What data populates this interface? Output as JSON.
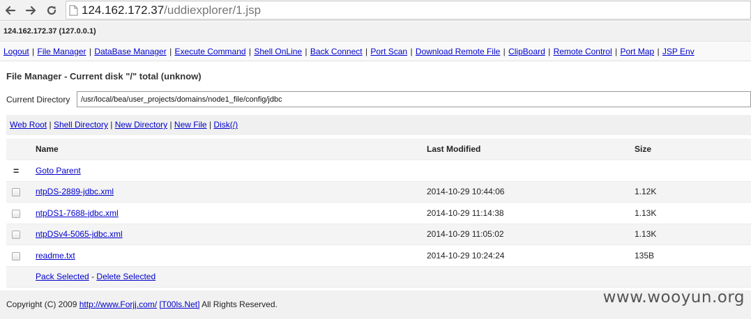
{
  "browser": {
    "url_host": "124.162.172.37",
    "url_path": "/uddiexplorer/1.jsp"
  },
  "host_header": "124.162.172.37 (127.0.0.1)",
  "menu": {
    "items": [
      "Logout",
      "File Manager",
      "DataBase Manager",
      "Execute Command",
      "Shell OnLine",
      "Back Connect",
      "Port Scan",
      "Download Remote File",
      "ClipBoard",
      "Remote Control",
      "Port Map",
      "JSP Env"
    ]
  },
  "file_manager": {
    "title": "File Manager - Current disk \"/\" total (unknow)",
    "current_dir_label": "Current Directory",
    "current_dir_value": "/usr/local/bea/user_projects/domains/node1_file/config/jdbc",
    "links": [
      "Web Root",
      "Shell Directory",
      "New Directory",
      "New File",
      "Disk(/)"
    ],
    "table": {
      "headers": {
        "name": "Name",
        "modified": "Last Modified",
        "size": "Size"
      },
      "parent_glyph": "=",
      "parent_label": "Goto Parent",
      "rows": [
        {
          "name": "ntpDS-2889-jdbc.xml",
          "modified": "2014-10-29 10:44:06",
          "size": "1.12K"
        },
        {
          "name": "ntpDS1-7688-jdbc.xml",
          "modified": "2014-10-29 11:14:38",
          "size": "1.13K"
        },
        {
          "name": "ntpDSv4-5065-jdbc.xml",
          "modified": "2014-10-29 11:05:02",
          "size": "1.13K"
        },
        {
          "name": "readme.txt",
          "modified": "2014-10-29 10:24:24",
          "size": "135B"
        }
      ],
      "pack_selected": "Pack Selected",
      "action_separator": "-",
      "delete_selected": "Delete Selected"
    }
  },
  "footer": {
    "copyright": "Copyright (C) 2009",
    "link1": "http://www.Forjj.com/",
    "link2": "[T00ls.Net]",
    "rights": "All Rights Reserved."
  },
  "watermark": "www.wooyun.org",
  "icons": {
    "back": "arrow-left-icon",
    "forward": "arrow-right-icon",
    "reload": "reload-icon",
    "page": "page-icon"
  },
  "colors": {
    "link": "#0000cc",
    "header_bg": "#f1f1f1"
  }
}
